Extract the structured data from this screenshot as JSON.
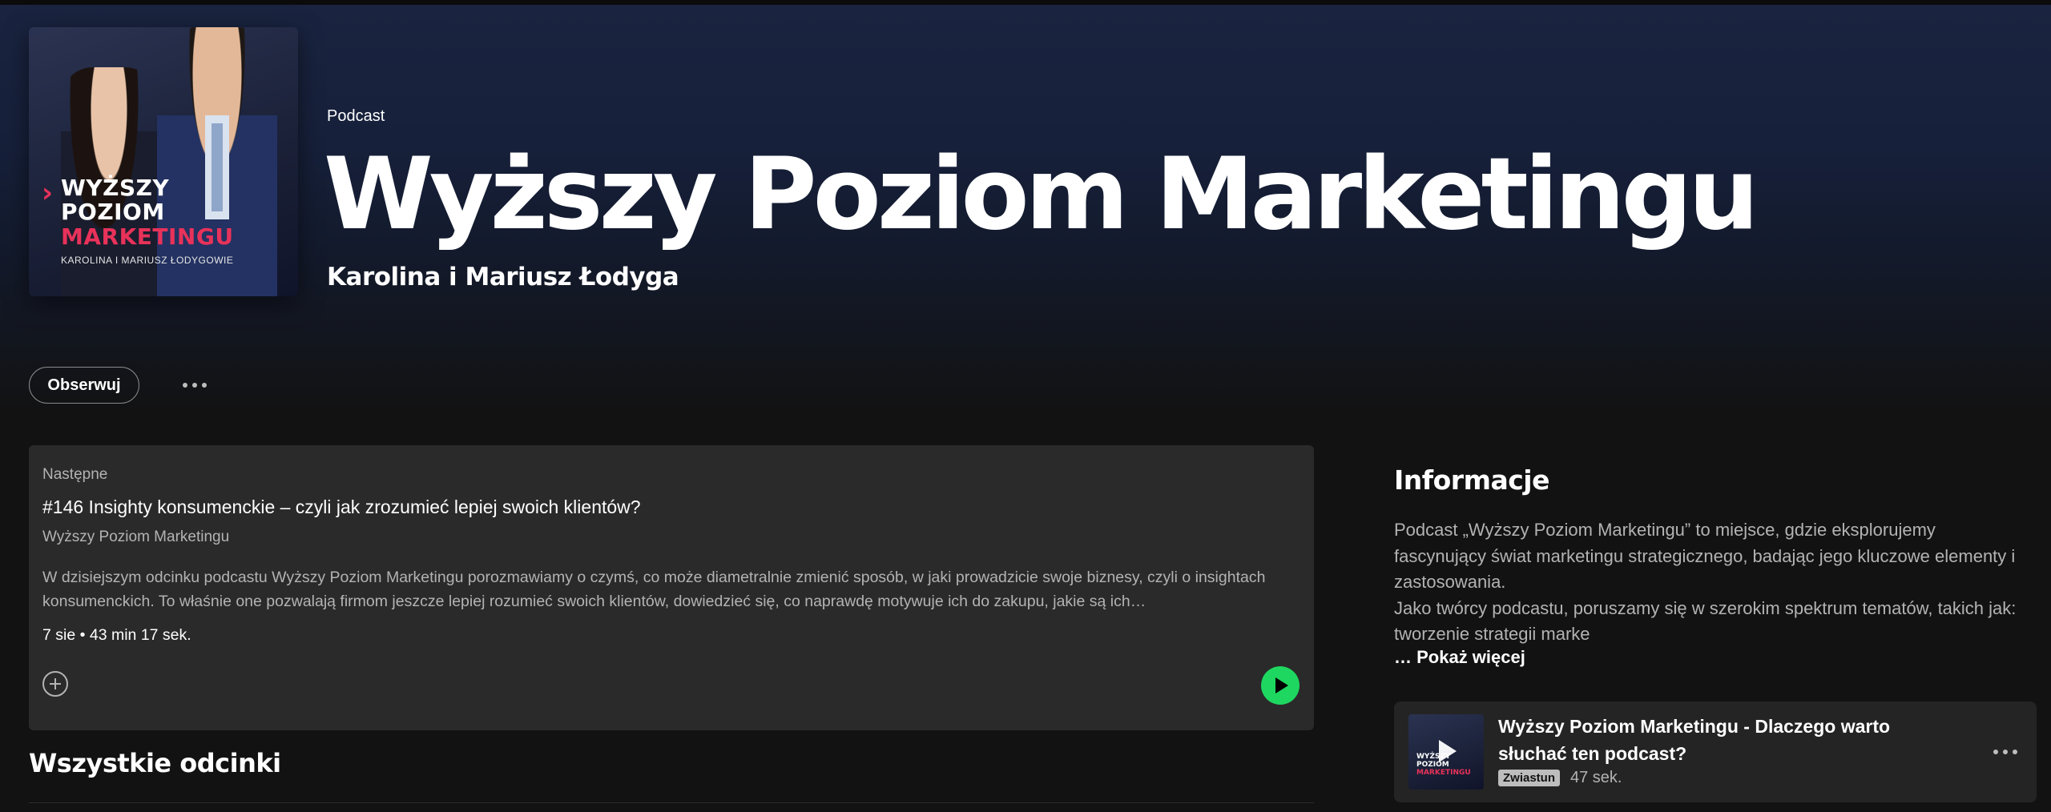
{
  "header": {
    "type_label": "Podcast",
    "title": "Wyższy Poziom Marketingu",
    "authors": "Karolina i Mariusz Łodyga"
  },
  "cover": {
    "line1": "WYŻSZY",
    "line2": "POZIOM",
    "line3": "MARKETINGU",
    "line4": "KAROLINA I MARIUSZ ŁODYGOWIE"
  },
  "actions": {
    "follow_label": "Obserwuj",
    "more_icon": "more-horizontal-icon"
  },
  "next_episode": {
    "label": "Następne",
    "title": "#146 Insighty konsumenckie – czyli jak zrozumieć lepiej swoich klientów?",
    "show": "Wyższy Poziom Marketingu",
    "description": "W dzisiejszym odcinku podcastu Wyższy Poziom Marketingu porozmawiamy o czymś, co może diametralnie zmienić sposób, w jaki prowadzicie swoje biznesy, czyli o insightach konsumenckich. To właśnie one pozwalają firmom jeszcze lepiej rozumieć swoich klientów, dowiedzieć się, co naprawdę motywuje ich do zakupu, jakie są ich…",
    "date": "7 sie",
    "separator": "•",
    "duration": "43 min 17 sek.",
    "add_icon": "add-circle-icon",
    "play_icon": "play-icon",
    "play_color": "#1ed760"
  },
  "episodes_section": {
    "title": "Wszystkie odcinki"
  },
  "info": {
    "title": "Informacje",
    "text_line1": "Podcast „Wyższy Poziom Marketingu” to miejsce, gdzie eksplorujemy fascynujący świat marketingu strategicznego, badając jego kluczowe elementy i zastosowania.",
    "text_line2": "Jako twórcy podcastu, poruszamy się w szerokim spektrum tematów, takich jak: tworzenie strategii marke",
    "show_more": "… Pokaż więcej"
  },
  "trailer": {
    "title": "Wyższy Poziom Marketingu - Dlaczego warto słuchać ten podcast?",
    "badge": "Zwiastun",
    "duration": "47 sek.",
    "thumb_line1": "WYŻSZY POZIOM",
    "thumb_line2": "MARKETINGU"
  },
  "colors": {
    "background": "#121212",
    "accent_green": "#1ed760",
    "brand_pink": "#e8325a",
    "hero_blue": "#1a2440"
  }
}
